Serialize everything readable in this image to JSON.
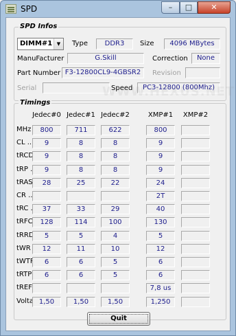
{
  "window": {
    "title": "SPD",
    "minimize_glyph": "–",
    "maximize_glyph": "□",
    "close_glyph": "✕"
  },
  "spd_infos": {
    "group_title": "SPD Infos",
    "slot": "DIMM#1",
    "type_label": "Type",
    "type_value": "DDR3",
    "size_label": "Size",
    "size_value": "4096 MBytes",
    "manufacturer_label": "ManuFacturer",
    "manufacturer_value": "G.Skill",
    "correction_label": "Correction",
    "correction_value": "None",
    "part_number_label": "Part Number",
    "part_number_value": "F3-12800CL9-4GBSR2",
    "revision_label": "Revision",
    "revision_value": "",
    "serial_label": "Serial",
    "serial_value": "",
    "speed_label": "Speed",
    "speed_value": "PC3-12800 (800Mhz)"
  },
  "timings": {
    "group_title": "Timings",
    "columns": [
      "Jedec#0",
      "Jedec#1",
      "Jedec#2",
      "XMP#1",
      "XMP#2"
    ],
    "rows": [
      {
        "label": "MHz",
        "values": [
          "800",
          "711",
          "622",
          "800",
          ""
        ]
      },
      {
        "label": "CL .......",
        "values": [
          "9",
          "8",
          "8",
          "9",
          ""
        ]
      },
      {
        "label": "tRCD ....",
        "values": [
          "9",
          "8",
          "8",
          "9",
          ""
        ]
      },
      {
        "label": "tRP ......",
        "values": [
          "9",
          "8",
          "8",
          "9",
          ""
        ]
      },
      {
        "label": "tRAS ....",
        "values": [
          "28",
          "25",
          "22",
          "24",
          ""
        ]
      },
      {
        "label": "CR .......",
        "values": [
          "",
          "",
          "",
          "2T",
          ""
        ]
      },
      {
        "label": "tRC ......",
        "values": [
          "37",
          "33",
          "29",
          "40",
          ""
        ]
      },
      {
        "label": "tRFC ....",
        "values": [
          "128",
          "114",
          "100",
          "130",
          ""
        ]
      },
      {
        "label": "tRRD ....",
        "values": [
          "5",
          "5",
          "4",
          "5",
          ""
        ]
      },
      {
        "label": "tWR ......",
        "values": [
          "12",
          "11",
          "10",
          "12",
          ""
        ]
      },
      {
        "label": "tWTR ....",
        "values": [
          "6",
          "6",
          "5",
          "6",
          ""
        ]
      },
      {
        "label": "tRTP ....",
        "values": [
          "6",
          "6",
          "5",
          "6",
          ""
        ]
      },
      {
        "label": "tREF ....",
        "values": [
          "",
          "",
          "",
          "7,8 us",
          ""
        ]
      },
      {
        "label": "Voltage",
        "values": [
          "1,50",
          "1,50",
          "1,50",
          "1,250",
          ""
        ]
      }
    ]
  },
  "quit_label": "Quit",
  "watermark": "WWW.HEXUS.NET"
}
